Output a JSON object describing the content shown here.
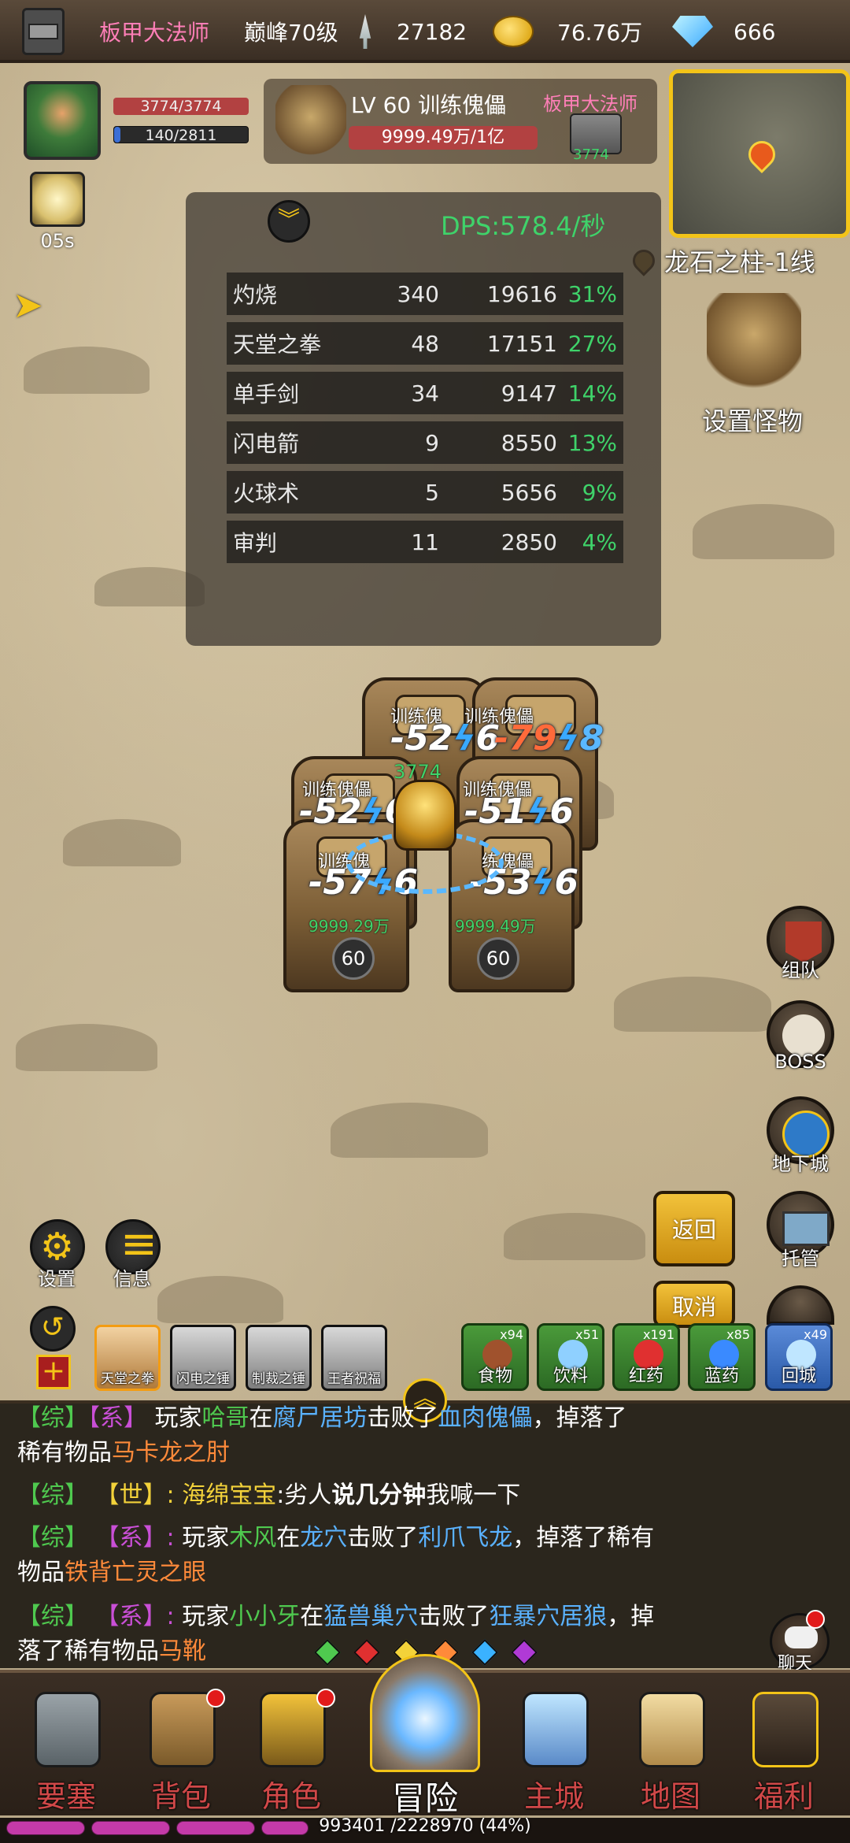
{
  "topbar": {
    "player_name": "板甲大法师",
    "level": "巅峰70级",
    "power": "27182",
    "gold": "76.76万",
    "gems": "666"
  },
  "hero": {
    "hp": "3774/3774",
    "mp": "140/2811",
    "buff_timer": "05s"
  },
  "target": {
    "name": "LV 60 训练傀儡",
    "hp": "9999.49万/1亿",
    "owner": "板甲大法师",
    "owner_hp": "3774"
  },
  "map": {
    "location": "龙石之柱-1线",
    "set_monster": "设置怪物"
  },
  "dps": {
    "value": "DPS:578.4/秒",
    "rows": [
      {
        "name": "灼烧",
        "hits": "340",
        "damage": "19616",
        "pct": "31%"
      },
      {
        "name": "天堂之拳",
        "hits": "48",
        "damage": "17151",
        "pct": "27%"
      },
      {
        "name": "单手剑",
        "hits": "34",
        "damage": "9147",
        "pct": "14%"
      },
      {
        "name": "闪电箭",
        "hits": "9",
        "damage": "8550",
        "pct": "13%"
      },
      {
        "name": "火球术",
        "hits": "5",
        "damage": "5656",
        "pct": "9%"
      },
      {
        "name": "审判",
        "hits": "11",
        "damage": "2850",
        "pct": "4%"
      }
    ]
  },
  "battle": {
    "monster_name": "训练傀儡",
    "monster_name_short": "训练傀",
    "monster_name_partial": "练傀儡",
    "dmg1": "-52",
    "dmg1b": "6",
    "dmg2": "-79",
    "dmg2b": "8",
    "dmg3": "-52",
    "dmg3b": "6",
    "dmg4": "-51",
    "dmg4b": "6",
    "dmg5": "-57",
    "dmg5b": "6",
    "dmg6": "-53",
    "dmg6b": "6",
    "hero_hp": "3774",
    "monster_hp_left": "9999.29万",
    "monster_hp_right": "9999.49万",
    "level_left": "60",
    "level_right": "60"
  },
  "side_buttons": {
    "team": "组队",
    "boss": "BOSS",
    "dungeon": "地下城",
    "auto": "托管",
    "back": "返回",
    "cancel": "取消"
  },
  "left_buttons": {
    "settings": "设置",
    "info": "信息"
  },
  "skills": [
    "天堂之拳",
    "闪电之锤",
    "制裁之锤",
    "王者祝福"
  ],
  "items": [
    {
      "label": "食物",
      "count": "x94"
    },
    {
      "label": "饮料",
      "count": "x51"
    },
    {
      "label": "红药",
      "count": "x191"
    },
    {
      "label": "蓝药",
      "count": "x85"
    },
    {
      "label": "回城",
      "count": "x49"
    }
  ],
  "chat": {
    "line0": {
      "tag1": "【综】",
      "tag2": "【系】",
      "pre": "玩家",
      "player": "哈哥",
      "at": "在",
      "place": "腐尸居坊",
      "verb": "击败了",
      "monster": "血肉傀儡",
      "tail": "，掉落了"
    },
    "line0b": {
      "pre": "稀有物品",
      "item": "马卡龙之肘"
    },
    "line1": {
      "tag1": "【综】",
      "tag2": "【世】",
      "sep": ":",
      "player": "海绵宝宝",
      "msg_a": ":劣人",
      "msg_b": "说几分钟",
      "msg_c": "我喊一下"
    },
    "line2": {
      "tag1": "【综】",
      "tag2": "【系】",
      "sep": ":",
      "pre": "玩家",
      "player": "木风",
      "at": "在",
      "place": "龙穴",
      "verb": "击败了",
      "monster": "利爪飞龙",
      "tail": "，掉落了稀有"
    },
    "line2b": {
      "pre": "物品",
      "item": "铁背亡灵之眼"
    },
    "line3": {
      "tag1": "【综】",
      "tag2": "【系】",
      "sep": ":",
      "pre": "玩家",
      "player": "小小牙",
      "at": "在",
      "place": "猛兽巢穴",
      "verb": "击败了",
      "monster": "狂暴穴居狼",
      "tail": "，掉"
    },
    "line3b": {
      "pre": "落了稀有物品",
      "item": "马靴"
    },
    "chat_label": "聊天"
  },
  "nav": [
    "要塞",
    "背包",
    "角色",
    "冒险",
    "主城",
    "地图",
    "福利"
  ],
  "exp": "993401 /2228970 (44%)",
  "colors": {
    "accent_gold": "#f3c418",
    "hp_red": "#b24141",
    "dps_green": "#3fd36a",
    "name_pink": "#ff7fb8"
  }
}
